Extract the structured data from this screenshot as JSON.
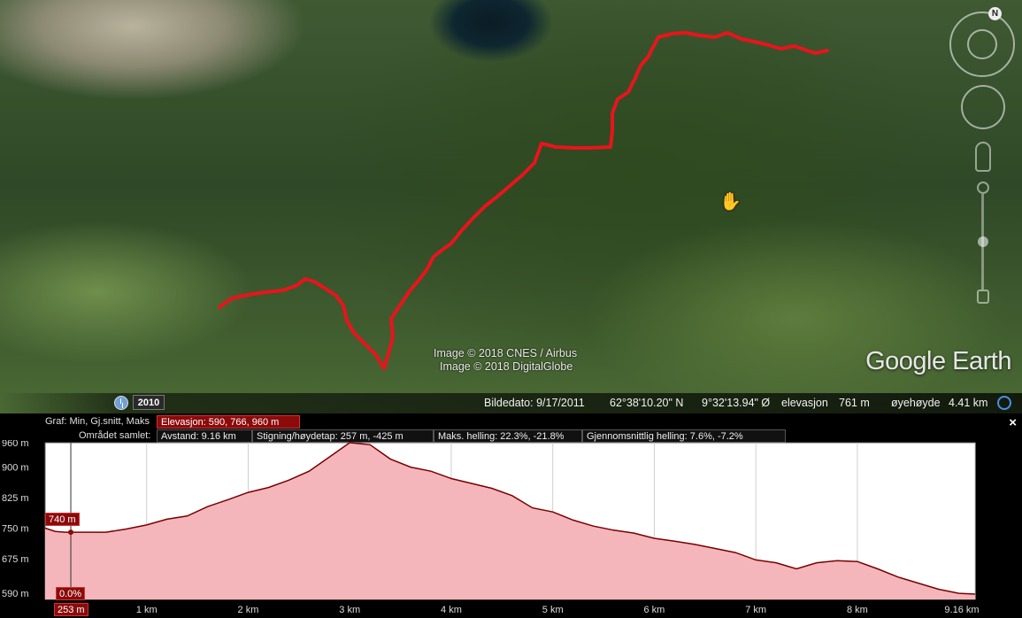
{
  "map": {
    "credits": [
      "Image © 2018 CNES / Airbus",
      "Image © 2018 DigitalGlobe"
    ],
    "logo": "Google Earth",
    "history_year": "2010",
    "compass_letter": "N",
    "route_color": "#e8141c"
  },
  "status_bar": {
    "image_date": "Bildedato: 9/17/2011",
    "latitude": "62°38'10.20\" N",
    "longitude": "9°32'13.94\" Ø",
    "elevation_label": "elevasjon",
    "elevation_value": "761 m",
    "eye_label": "øyehøyde",
    "eye_value": "4.41 km"
  },
  "elevation_panel": {
    "graph_label": "Graf: Min, Gj.snitt, Maks",
    "graph_value": "Elevasjon: 590, 766, 960 m",
    "area_label": "Området samlet:",
    "distance": "Avstand: 9.16 km",
    "gain_loss": "Stigning/høydetap: 257 m, -425 m",
    "max_slope": "Maks. helling: 22.3%, -21.8%",
    "avg_slope": "Gjennomsnittlig helling: 7.6%, -7.2%",
    "close_label": "×",
    "cursor_elevation": "740 m",
    "cursor_slope": "0.0%",
    "cursor_distance": "253 m"
  },
  "chart_data": {
    "type": "area",
    "title": "",
    "xlabel": "",
    "ylabel": "",
    "x_ticks": [
      "1 km",
      "2 km",
      "3 km",
      "4 km",
      "5 km",
      "6 km",
      "7 km",
      "8 km",
      "9.16 km"
    ],
    "y_ticks": [
      "960 m",
      "900 m",
      "825 m",
      "750 m",
      "675 m",
      "590 m"
    ],
    "xlim": [
      0,
      9.16
    ],
    "ylim": [
      575,
      960
    ],
    "fill_color": "#f4b6bb",
    "line_color": "#7a0000",
    "x": [
      0,
      0.1,
      0.2,
      0.25,
      0.4,
      0.6,
      0.8,
      1.0,
      1.2,
      1.4,
      1.6,
      1.8,
      2.0,
      2.2,
      2.4,
      2.6,
      2.8,
      3.0,
      3.2,
      3.4,
      3.6,
      3.8,
      4.0,
      4.2,
      4.4,
      4.6,
      4.8,
      5.0,
      5.2,
      5.4,
      5.6,
      5.8,
      6.0,
      6.2,
      6.4,
      6.6,
      6.8,
      7.0,
      7.2,
      7.4,
      7.6,
      7.8,
      8.0,
      8.2,
      8.4,
      8.6,
      8.8,
      9.0,
      9.16
    ],
    "y": [
      750,
      742,
      740,
      740,
      740,
      740,
      748,
      758,
      772,
      780,
      803,
      820,
      838,
      850,
      868,
      890,
      925,
      960,
      955,
      920,
      900,
      890,
      872,
      860,
      848,
      830,
      800,
      790,
      770,
      755,
      745,
      738,
      725,
      718,
      710,
      700,
      690,
      672,
      665,
      650,
      665,
      670,
      668,
      650,
      630,
      615,
      600,
      590,
      588
    ]
  }
}
